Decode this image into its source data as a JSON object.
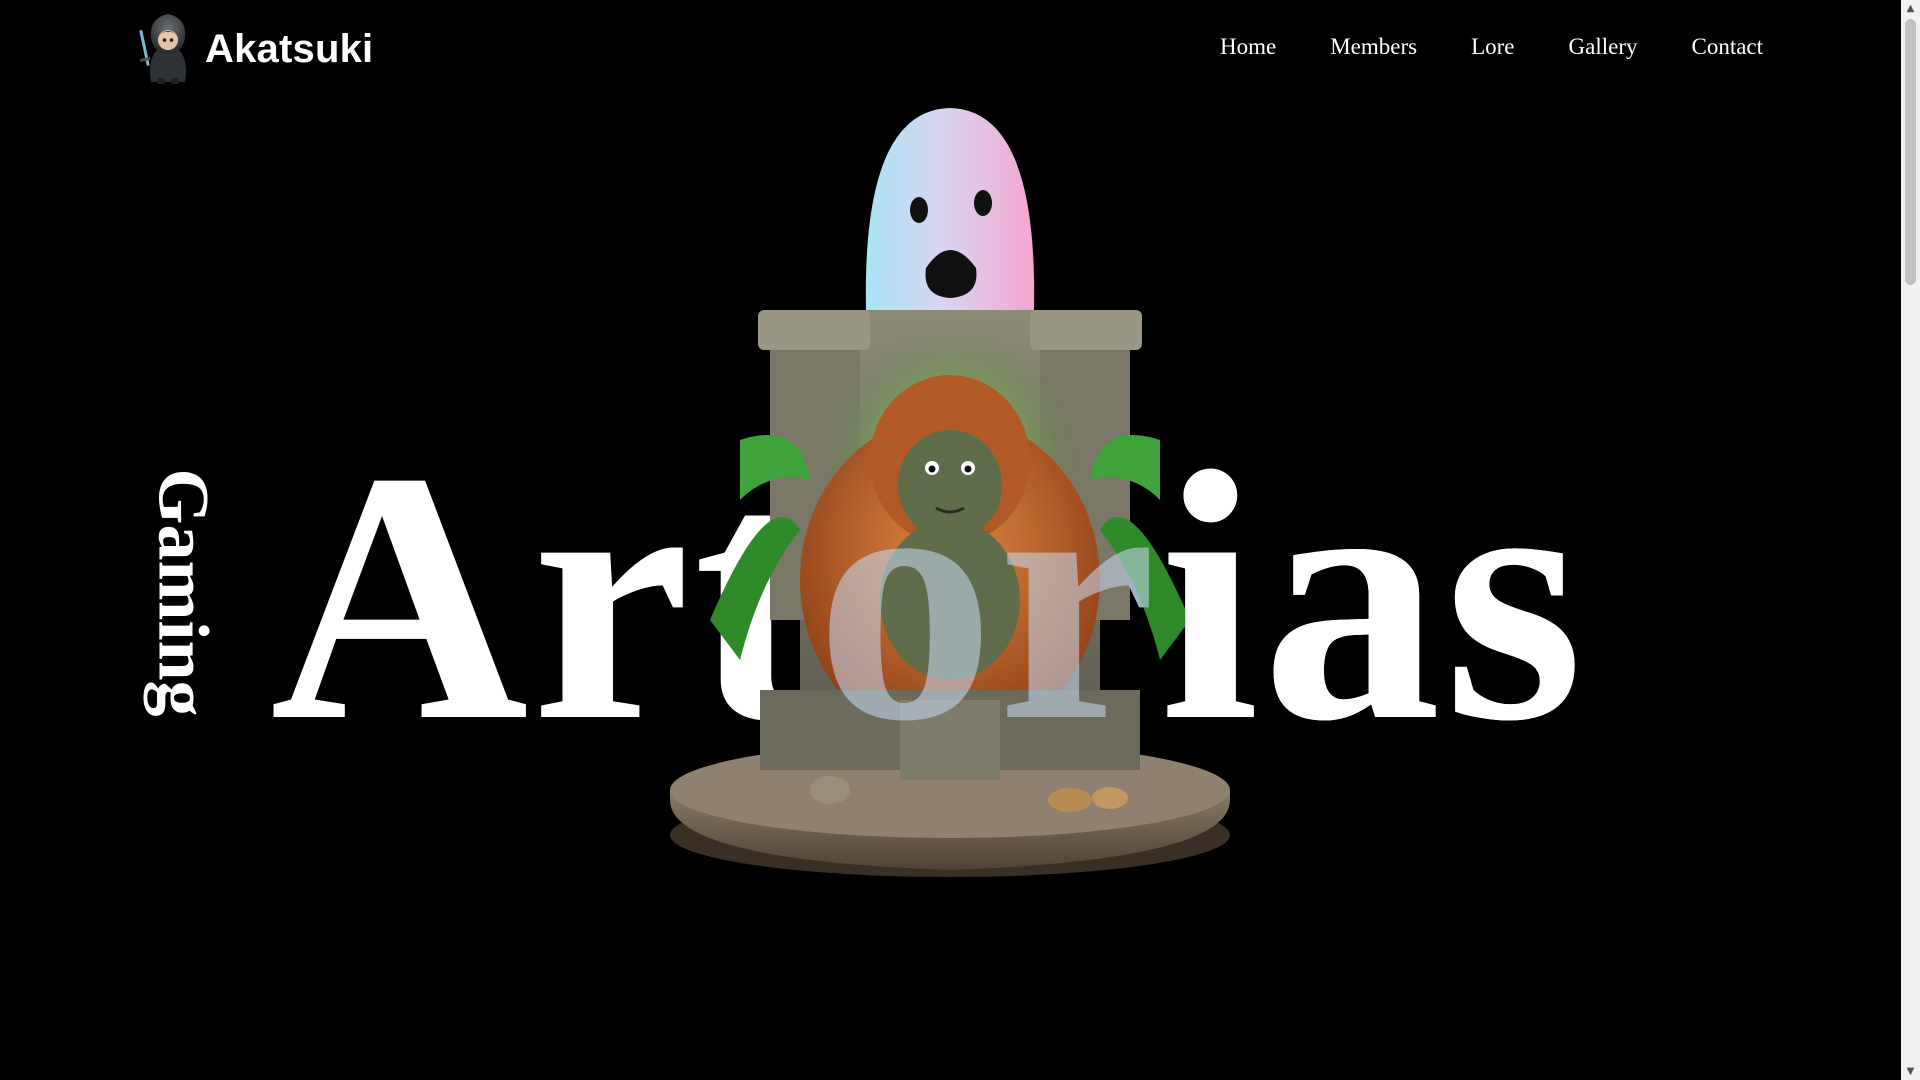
{
  "brand": {
    "name": "Akatsuki",
    "logo_icon": "ninja-character-icon"
  },
  "nav": {
    "items": [
      {
        "label": "Home"
      },
      {
        "label": "Members"
      },
      {
        "label": "Lore"
      },
      {
        "label": "Gallery"
      },
      {
        "label": "Contact"
      }
    ]
  },
  "hero": {
    "title_left": "Art",
    "title_mid": "or",
    "title_right": "ias",
    "subtitle": "Gaming",
    "artwork": "ghost-and-gorilla-throne-illustration"
  },
  "colors": {
    "background": "#000000",
    "text": "#ffffff",
    "ghost_pink": "#f3a6d0",
    "ghost_blue": "#a9e4f5",
    "gorilla_fur": "#c8642a"
  }
}
